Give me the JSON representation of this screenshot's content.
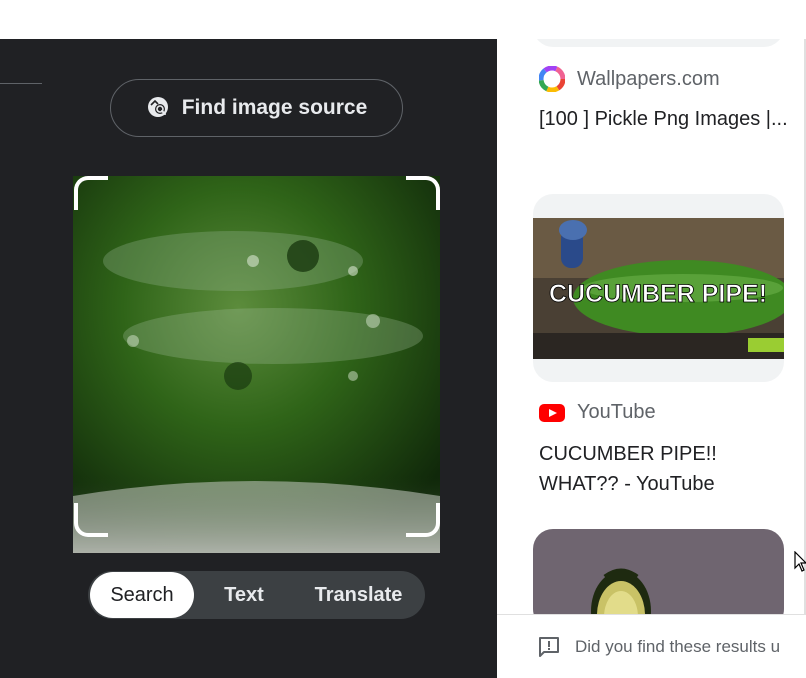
{
  "lens": {
    "find_source_label": "Find image source",
    "modes": [
      "Search",
      "Text",
      "Translate"
    ],
    "active_mode": "Search"
  },
  "results": [
    {
      "source": "Wallpapers.com",
      "source_icon": "colorful-wheel-icon",
      "title": "[100 ] Pickle Png Images |..."
    },
    {
      "thumbnail_text": "CUCUMBER PIPE!",
      "source": "YouTube",
      "source_icon": "youtube-icon",
      "title": "CUCUMBER PIPE!! WHAT?? - YouTube"
    },
    {
      "thumbnail": "avocado-image"
    }
  ],
  "feedback": {
    "text": "Did you find these results u",
    "icon": "feedback-icon"
  },
  "colors": {
    "panel_bg": "#202124",
    "youtube_red": "#ff0000",
    "thumb_bg": "#f1f3f4"
  }
}
